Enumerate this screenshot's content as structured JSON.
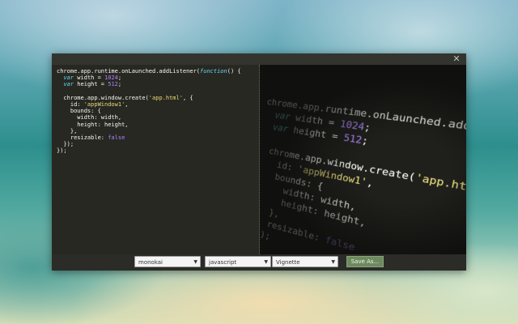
{
  "window": {
    "close_symbol": "✕"
  },
  "editor": {
    "lines": [
      "chrome.app.runtime.onLaunched.addListener(function() {",
      "  var width = 1024;",
      "  var height = 512;",
      "",
      "  chrome.app.window.create('app.html', {",
      "    id: 'appWindow1',",
      "    bounds: {",
      "      width: width,",
      "      height: height,",
      "    },",
      "    resizable: false",
      "  });",
      "});"
    ]
  },
  "preview": {
    "lines": [
      "chrome.app.runtime.onLaunched.addListener(",
      "  var width = 1024;",
      "  var height = 512;",
      "",
      "  chrome.app.window.create('app.html', {",
      "    id: 'appWindow1',",
      "    bounds: {",
      "      width: width,",
      "      height: height,",
      "    },",
      "    resizable: false",
      "  });",
      "});"
    ]
  },
  "toolbar": {
    "theme_select": "monokai",
    "language_select": "javascript",
    "effect_select": "Vignette",
    "save_label": "Save As..."
  },
  "colors": {
    "editor_bg": "#272822",
    "save_button": "#6d8a5e"
  }
}
